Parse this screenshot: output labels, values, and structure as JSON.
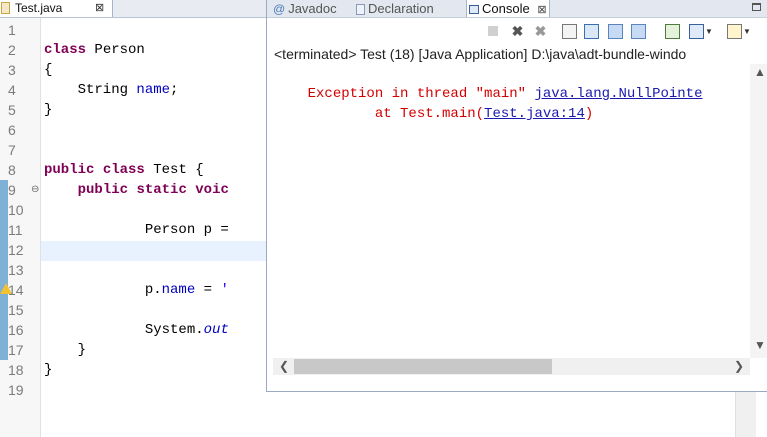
{
  "editor": {
    "tab": {
      "label": "Test.java",
      "close": "⊠"
    },
    "line_numbers": [
      "1",
      "2",
      "3",
      "4",
      "5",
      "6",
      "7",
      "8",
      "9",
      "10",
      "11",
      "12",
      "13",
      "14",
      "15",
      "16",
      "17",
      "18",
      "19"
    ],
    "lines": {
      "l2": {
        "kw": "class",
        "rest": " Person"
      },
      "l3": "{",
      "l4": {
        "pre": "    String ",
        "field": "name",
        "post": ";"
      },
      "l5": "}",
      "l8": {
        "kw1": "public",
        "kw2": "class",
        "rest": " Test {"
      },
      "l9": {
        "pre": "    ",
        "kw1": "public",
        "kw2": "static",
        "kw3": "voic"
      },
      "l11": "            Person p = ",
      "l14": {
        "pre": "            p.",
        "field": "name",
        "post": " = ",
        "str": "'"
      },
      "l16": {
        "pre": "            System.",
        "italic": "out"
      },
      "l17": "    }",
      "l18": "}"
    }
  },
  "console": {
    "tabs": [
      {
        "label": "Javadoc",
        "icon": "javadoc-icon"
      },
      {
        "label": "Declaration",
        "icon": "declaration-icon"
      },
      {
        "label": "Console",
        "icon": "console-icon",
        "close": "⊠"
      }
    ],
    "description": "<terminated> Test (18) [Java Application] D:\\java\\adt-bundle-windo",
    "output": {
      "line1_text": "Exception in thread \"main\" ",
      "line1_link": "java.lang.NullPointe",
      "line2_pre": "        at Test.main(",
      "line2_link": "Test.java:14",
      "line2_post": ")"
    }
  },
  "colors": {
    "keyword": "#7f0055",
    "error": "#d40000",
    "link": "#1a1ab0"
  }
}
